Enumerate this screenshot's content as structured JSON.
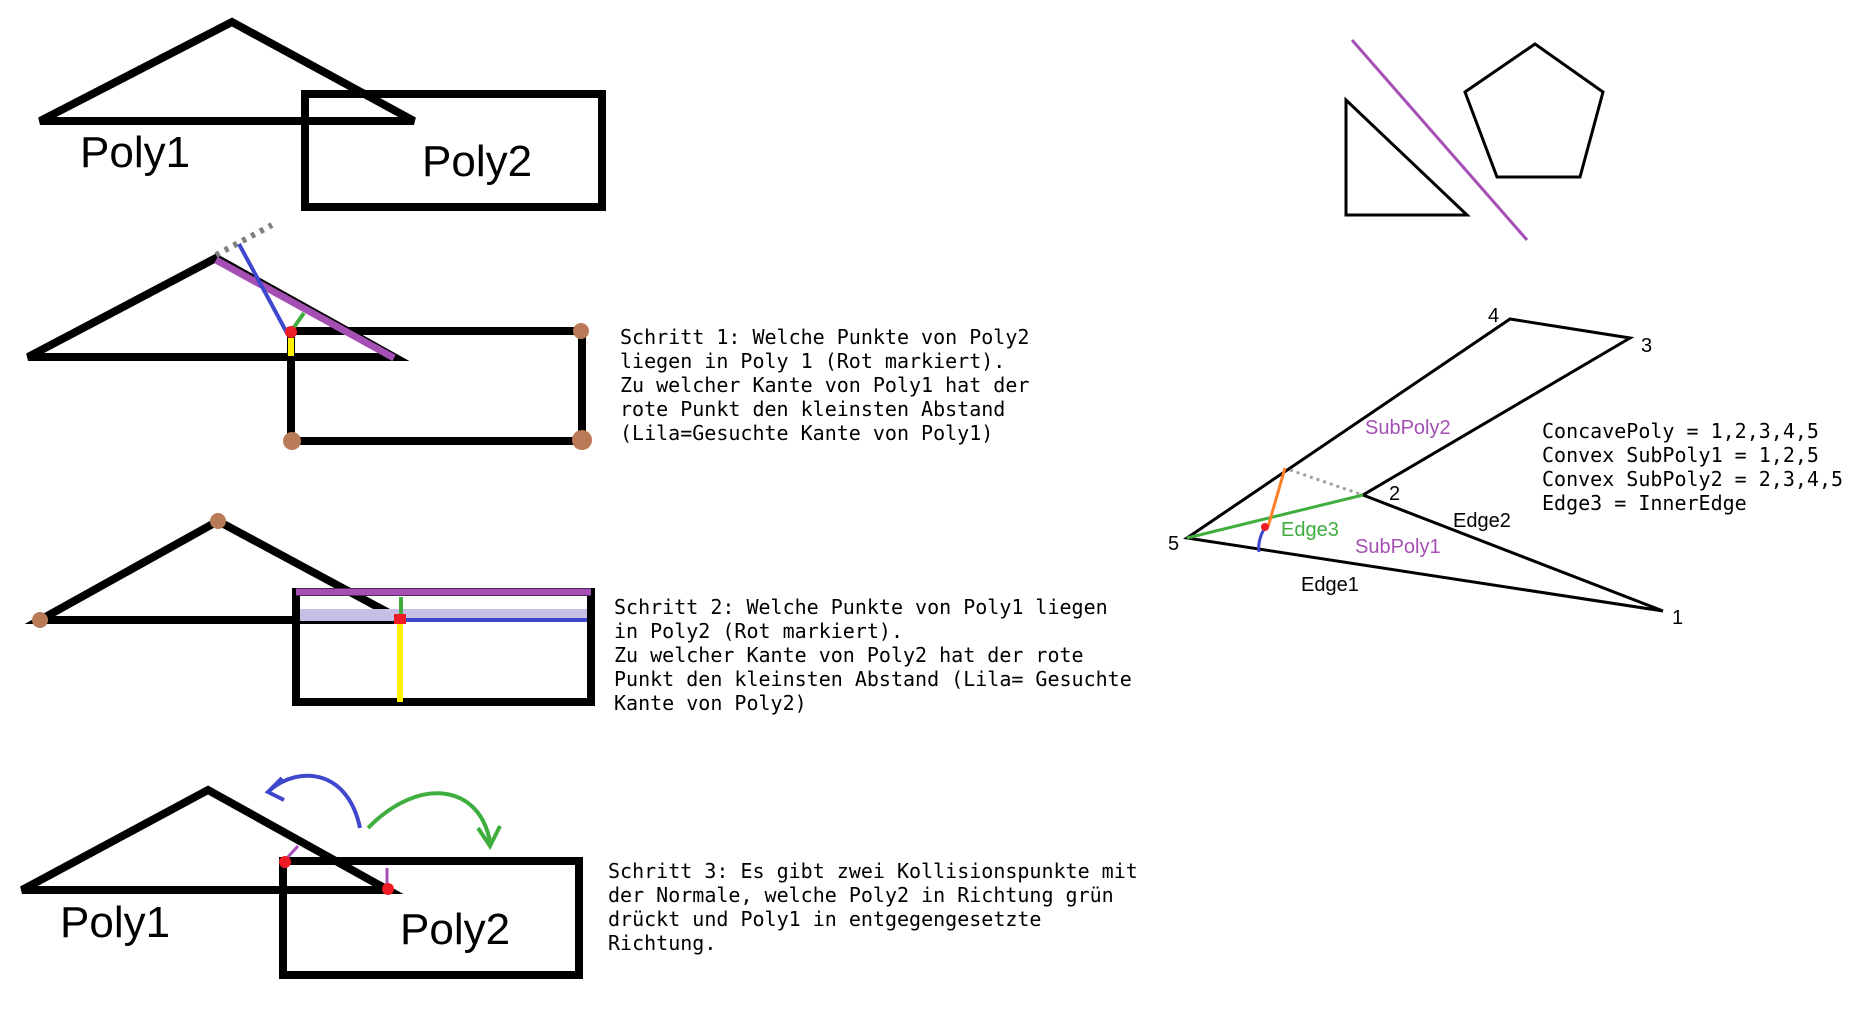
{
  "section1": {
    "poly1_label": "Poly1",
    "poly2_label": "Poly2"
  },
  "step1": {
    "lines": [
      "Schritt 1: Welche Punkte von Poly2",
      "liegen in Poly 1 (Rot markiert).",
      "",
      "Zu welcher Kante von Poly1 hat der",
      "rote Punkt den kleinsten Abstand",
      "(Lila=Gesuchte Kante von Poly1)"
    ]
  },
  "step2": {
    "lines": [
      "Schritt 2: Welche Punkte von Poly1 liegen",
      "in Poly2 (Rot markiert).",
      "",
      "Zu welcher Kante von Poly2 hat der rote",
      "Punkt den kleinsten Abstand (Lila= Gesuchte",
      "Kante von Poly2)"
    ]
  },
  "step3": {
    "lines": [
      "Schritt 3: Es gibt zwei Kollisionspunkte mit",
      "der Normale, welche Poly2 in Richtung grün",
      "drückt und Poly1 in entgegengesetzte",
      "Richtung."
    ],
    "poly1_label": "Poly1",
    "poly2_label": "Poly2"
  },
  "concave": {
    "vertex_labels": [
      "1",
      "2",
      "3",
      "4",
      "5"
    ],
    "edge_labels": {
      "edge1": "Edge1",
      "edge2": "Edge2",
      "edge3": "Edge3"
    },
    "subpoly_labels": {
      "sub1": "SubPoly1",
      "sub2": "SubPoly2"
    },
    "info": [
      "ConcavePoly = 1,2,3,4,5",
      "Convex SubPoly1 = 1,2,5",
      "Convex SubPoly2 = 2,3,4,5",
      "Edge3 = InnerEdge"
    ]
  },
  "colors": {
    "black": "#000000",
    "red": "#ee1c24",
    "purple": "#a54fb5",
    "blue": "#3f48cc",
    "yellow": "#fff200",
    "green": "#3fae3f",
    "brown": "#b97a57",
    "gray": "#808080",
    "orange": "#ff7f27",
    "lavender": "#c8bfe7"
  }
}
